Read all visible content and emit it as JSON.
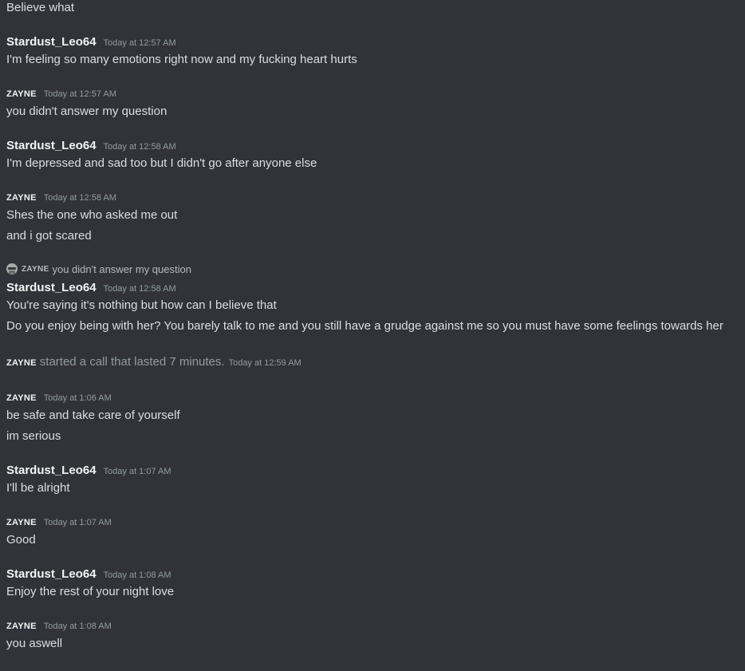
{
  "messages": {
    "m0": {
      "text": "Believe what"
    },
    "m1": {
      "author": "Stardust_Leo64",
      "timestamp": "Today at 12:57 AM",
      "lines": [
        "I'm feeling so many emotions right now and my fucking heart hurts"
      ]
    },
    "m2": {
      "author": "ZAYNE",
      "timestamp": "Today at 12:57 AM",
      "lines": [
        "you didn't answer my question"
      ]
    },
    "m3": {
      "author": "Stardust_Leo64",
      "timestamp": "Today at 12:58 AM",
      "lines": [
        "I'm depressed and sad too but I didn't go after anyone else"
      ]
    },
    "m4": {
      "author": "ZAYNE",
      "timestamp": "Today at 12:58 AM",
      "lines": [
        "Shes the one who asked me  out",
        "and i got scared"
      ]
    },
    "m5": {
      "reply": {
        "author": "ZAYNE",
        "text": "you didn't answer my question",
        "avatar_icon": "sunglasses-avatar-icon"
      },
      "author": "Stardust_Leo64",
      "timestamp": "Today at 12:58 AM",
      "lines": [
        "You're saying it's nothing but how can I believe that",
        "Do you enjoy being with her? You barely talk to me and you still have a grudge against me so you must have some feelings towards her"
      ]
    },
    "m6": {
      "author": "ZAYNE",
      "text": "started a call that lasted 7 minutes.",
      "timestamp": "Today at 12:59 AM"
    },
    "m7": {
      "author": "ZAYNE",
      "timestamp": "Today at 1:06 AM",
      "lines": [
        "be safe and take care of yourself",
        "im serious"
      ]
    },
    "m8": {
      "author": "Stardust_Leo64",
      "timestamp": "Today at 1:07 AM",
      "lines": [
        "I'll be alright"
      ]
    },
    "m9": {
      "author": "ZAYNE",
      "timestamp": "Today at 1:07 AM",
      "lines": [
        "Good"
      ]
    },
    "m10": {
      "author": "Stardust_Leo64",
      "timestamp": "Today at 1:08 AM",
      "lines": [
        "Enjoy the rest of your night love"
      ]
    },
    "m11": {
      "author": "ZAYNE",
      "timestamp": "Today at 1:08 AM",
      "lines": [
        "you aswell"
      ]
    }
  },
  "colors": {
    "background": "#313338",
    "text": "#dbdee1",
    "username": "#f2f3f5",
    "timestamp": "#949ba4",
    "muted": "#b5bac1"
  }
}
